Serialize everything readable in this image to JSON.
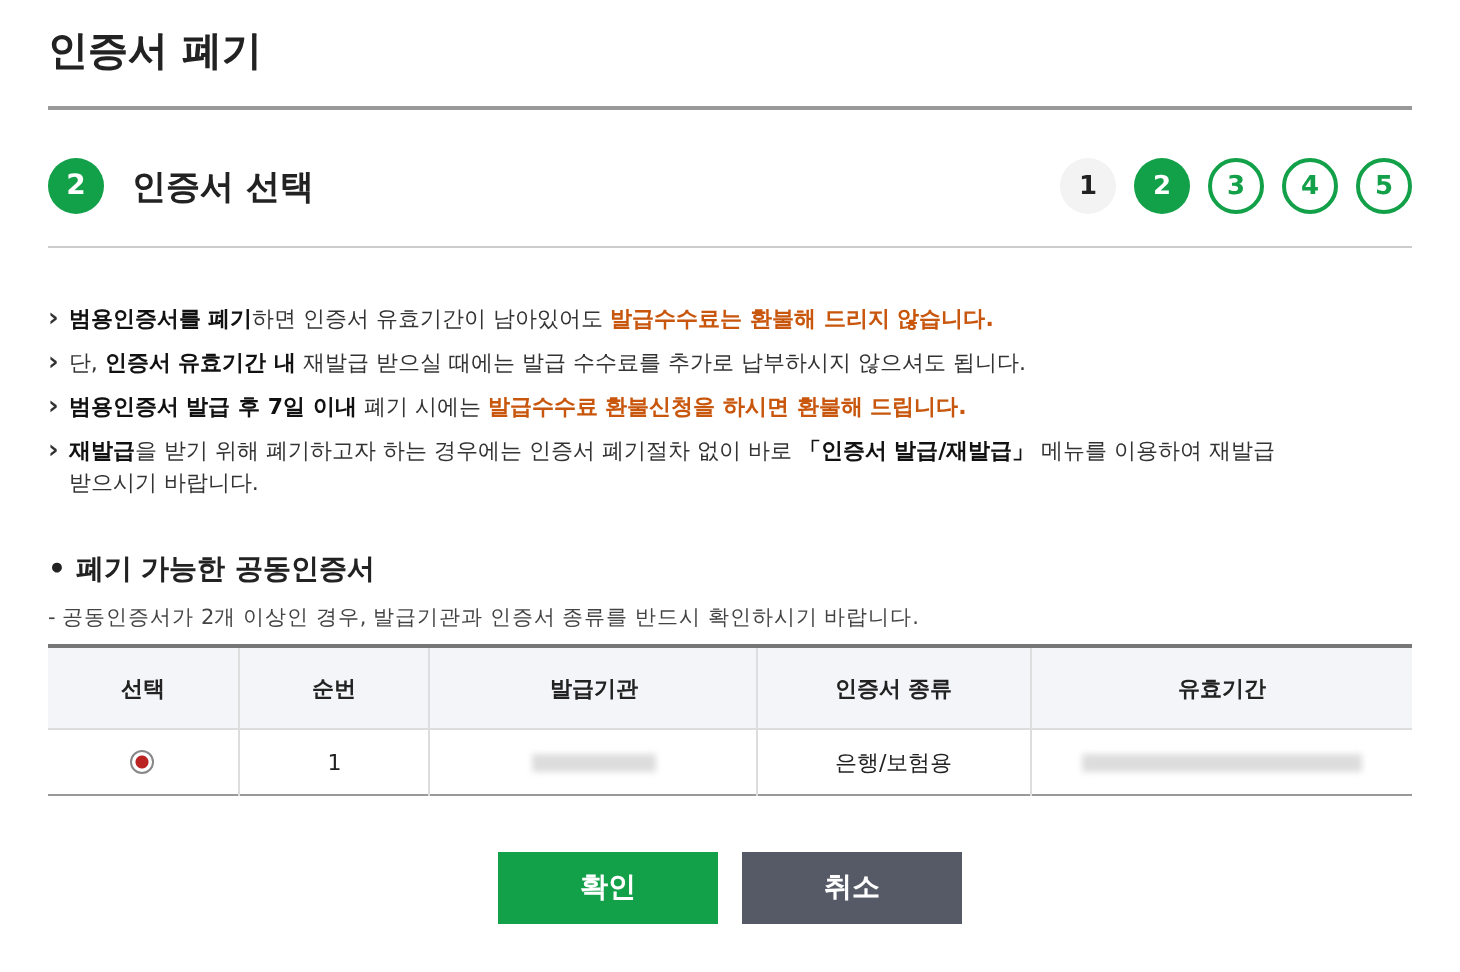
{
  "page_title": "인증서 폐기",
  "step": {
    "number": "2",
    "title": "인증서 선택"
  },
  "steps": [
    {
      "label": "1",
      "kind": "done"
    },
    {
      "label": "2",
      "kind": "current"
    },
    {
      "label": "3",
      "kind": "upcoming"
    },
    {
      "label": "4",
      "kind": "upcoming"
    },
    {
      "label": "5",
      "kind": "upcoming"
    }
  ],
  "marker": "›",
  "notices": [
    [
      {
        "text": "범용인증서를 폐기",
        "kind": "bold"
      },
      {
        "text": "하면 인증서 유효기간이 남아있어도 ",
        "kind": "plain"
      },
      {
        "text": "발급수수료는 환불해 드리지 않습니다.",
        "kind": "alert"
      }
    ],
    [
      {
        "text": "단, ",
        "kind": "plain"
      },
      {
        "text": "인증서 유효기간 내",
        "kind": "bold"
      },
      {
        "text": " 재발급 받으실 때에는 발급 수수료를 추가로 납부하시지 않으셔도 됩니다.",
        "kind": "plain"
      }
    ],
    [
      {
        "text": "범용인증서 발급 후 7일 이내",
        "kind": "bold"
      },
      {
        "text": " 폐기 시에는 ",
        "kind": "plain"
      },
      {
        "text": "발급수수료 환불신청을 하시면 환불해 드립니다.",
        "kind": "alert"
      }
    ],
    [
      {
        "text": "재발급",
        "kind": "bold"
      },
      {
        "text": "을 받기 위해 폐기하고자 하는 경우에는 인증서 폐기절차 없이 바로 ",
        "kind": "plain"
      },
      {
        "text": "「인증서 발급/재발급」",
        "kind": "bold"
      },
      {
        "text": " 메뉴를 이용하여 재발급 받으시기 바랍니다.",
        "kind": "plain"
      }
    ]
  ],
  "section_marker": "•",
  "section_title": "폐기 가능한 공동인증서",
  "section_note": "- 공동인증서가 2개 이상인 경우, 발급기관과 인증서 종류를 반드시 확인하시기 바랍니다.",
  "table": {
    "columns": [
      "선택",
      "순번",
      "발급기관",
      "인증서 종류",
      "유효기간"
    ],
    "rows": [
      {
        "selected": true,
        "number": "1",
        "type": "은행/보험용"
      }
    ]
  },
  "buttons": [
    {
      "label": "확인",
      "kind": "primary"
    },
    {
      "label": "취소",
      "kind": "secondary"
    }
  ]
}
